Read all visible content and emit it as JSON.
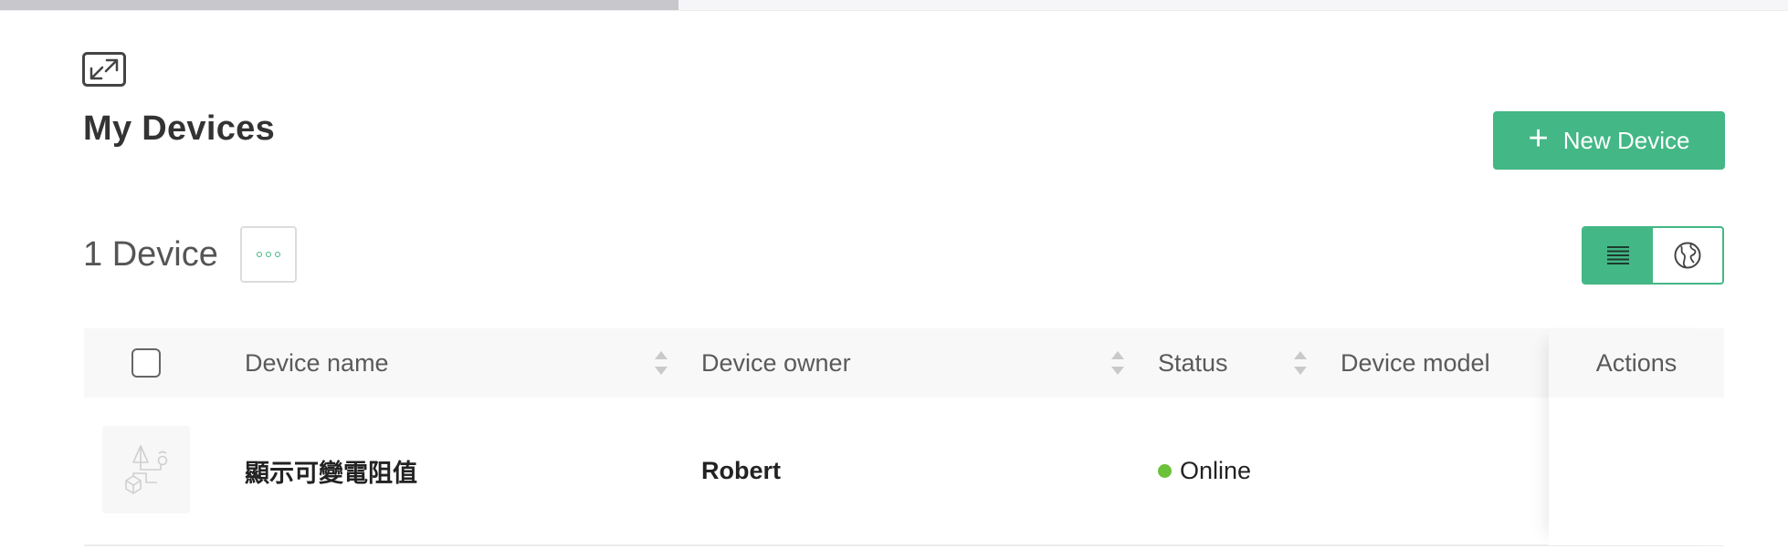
{
  "page": {
    "title": "My Devices",
    "new_device_label": "New Device",
    "device_count": "1 Device"
  },
  "icons": {
    "fullscreen": "expand-arrows-icon",
    "more": "more-options-icon",
    "list_view": "list-view-icon",
    "map_view": "globe-icon",
    "new_device": "plus-icon"
  },
  "colors": {
    "accent": "#43b785",
    "online": "#6cc13a"
  },
  "table": {
    "columns": {
      "device_name": "Device name",
      "device_owner": "Device owner",
      "status": "Status",
      "device_model": "Device model",
      "actions": "Actions"
    },
    "rows": [
      {
        "device_name": "顯示可變電阻值",
        "device_owner": "Robert",
        "status": "Online",
        "device_model": ""
      }
    ]
  }
}
